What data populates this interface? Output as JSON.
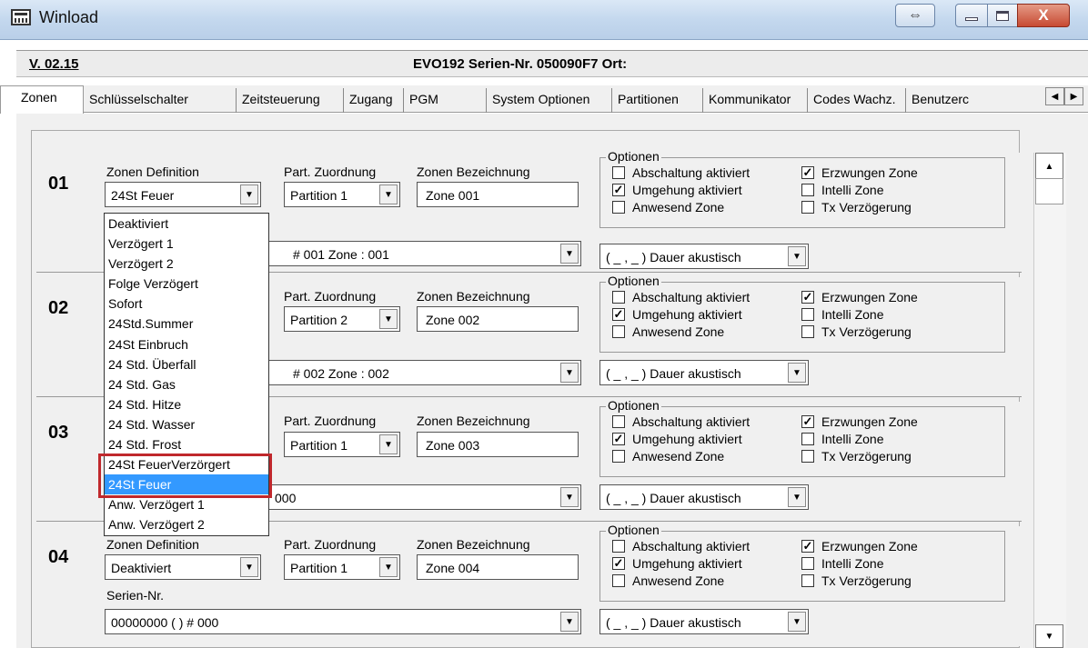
{
  "window": {
    "title": "Winload",
    "close_label": "X",
    "resize_label": "⇔"
  },
  "header": {
    "version": "V. 02.15",
    "device": "EVO192  Serien-Nr. 050090F7 Ort:"
  },
  "tabs": [
    "Zonen",
    "Schlüsselschalter",
    "Zeitsteuerung",
    "Zugang",
    "PGM",
    "System Optionen",
    "Partitionen",
    "Kommunikator",
    "Codes Wachz.",
    "Benutzerc"
  ],
  "labels": {
    "zone_def": "Zonen Definition",
    "part": "Part. Zuordnung",
    "name": "Zonen Bezeichnung",
    "serial": "Serien-Nr.",
    "options": "Optionen",
    "opt_a": "Abschaltung aktiviert",
    "opt_b": "Umgehung aktiviert",
    "opt_c": "Anwesend Zone",
    "opt_d": "Erzwungen Zone",
    "opt_e": "Intelli Zone",
    "opt_f": "Tx Verzögerung",
    "dauer": "( _ , _ ) Dauer akustisch"
  },
  "zones": [
    {
      "num": "01",
      "definition": "24St Feuer",
      "partition": "Partition  1",
      "name": "Zone 001",
      "serial": "# 001 Zone   : 001"
    },
    {
      "num": "02",
      "definition": "",
      "partition": "Partition  2",
      "name": "Zone 002",
      "serial": "# 002 Zone   : 002"
    },
    {
      "num": "03",
      "definition": "",
      "partition": "Partition  1",
      "name": "Zone 003",
      "serial": "000"
    },
    {
      "num": "04",
      "definition": "Deaktiviert",
      "partition": "Partition  1",
      "name": "Zone 004",
      "serial": "00000000 (          ) # 000"
    }
  ],
  "dropdown": {
    "items": [
      "Deaktiviert",
      "Verzögert 1",
      "Verzögert 2",
      "Folge Verzögert",
      "Sofort",
      "24Std.Summer",
      "24St Einbruch",
      "24 Std. Überfall",
      "24 Std. Gas",
      "24 Std. Hitze",
      "24 Std. Wasser",
      "24 Std. Frost",
      "24St FeuerVerzörgert",
      "24St Feuer",
      "Anw. Verzögert 1",
      "Anw. Verzögert 2"
    ],
    "selected": "24St Feuer"
  }
}
